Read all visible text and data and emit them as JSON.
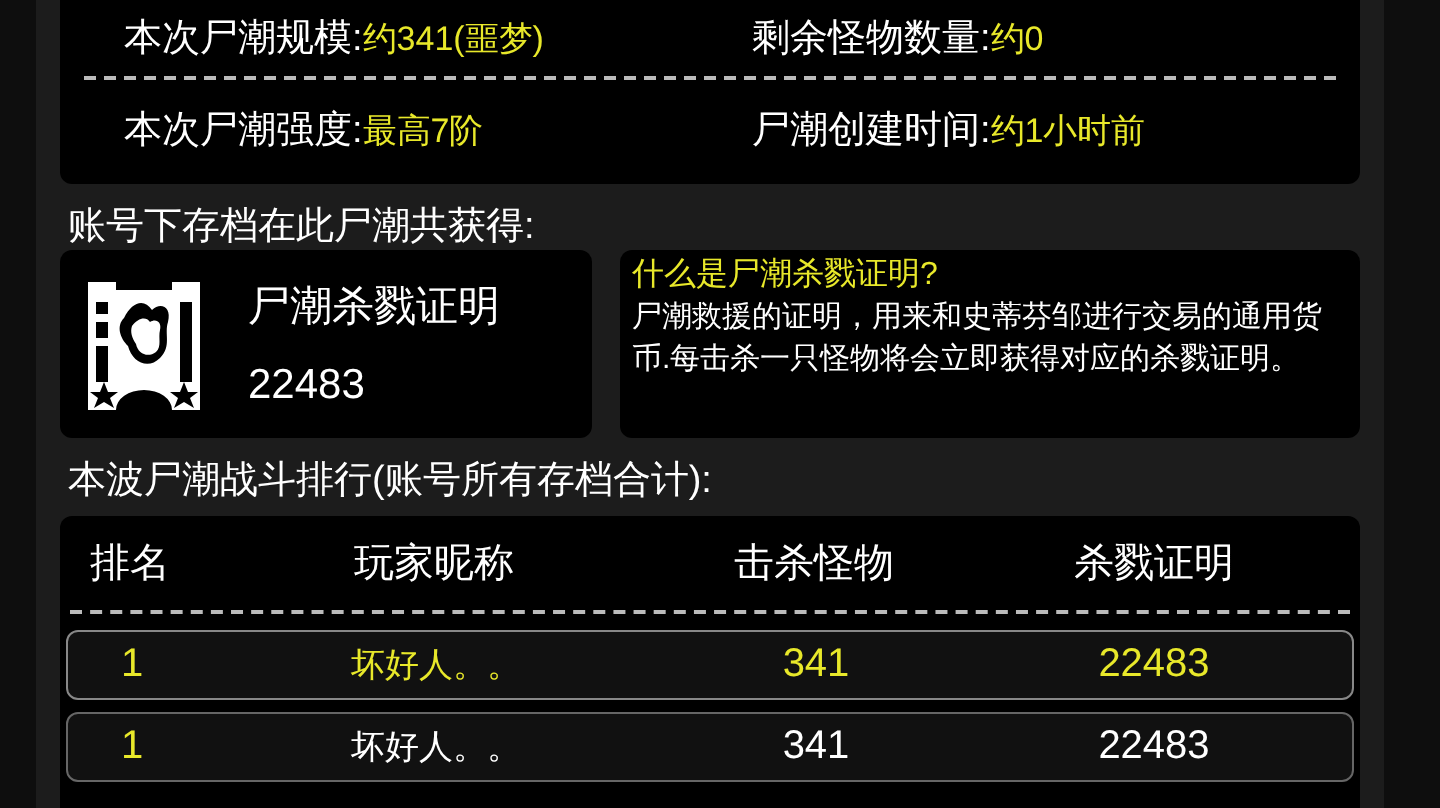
{
  "stats": [
    {
      "label": "本次尸潮规模:",
      "value": "约341(噩梦)"
    },
    {
      "label": "剩余怪物数量:",
      "value": "约0"
    },
    {
      "label": "本次尸潮强度:",
      "value": "最高7阶"
    },
    {
      "label": "尸潮创建时间:",
      "value": "约1小时前"
    }
  ],
  "earned_heading": "账号下存档在此尸潮共获得:",
  "reward": {
    "name": "尸潮杀戮证明",
    "count": "22483"
  },
  "info": {
    "title": "什么是尸潮杀戮证明?",
    "text": "尸潮救援的证明，用来和史蒂芬邹进行交易的通用货币.每击杀一只怪物将会立即获得对应的杀戮证明。"
  },
  "ranking_heading": "本波尸潮战斗排行(账号所有存档合计):",
  "table": {
    "columns": [
      "排名",
      "玩家昵称",
      "击杀怪物",
      "杀戮证明"
    ],
    "rows": [
      {
        "rank": "1",
        "name": "坏好人。。",
        "kills": "341",
        "proofs": "22483",
        "highlighted": true
      },
      {
        "rank": "1",
        "name": "坏好人。。",
        "kills": "341",
        "proofs": "22483",
        "highlighted": false
      }
    ]
  }
}
